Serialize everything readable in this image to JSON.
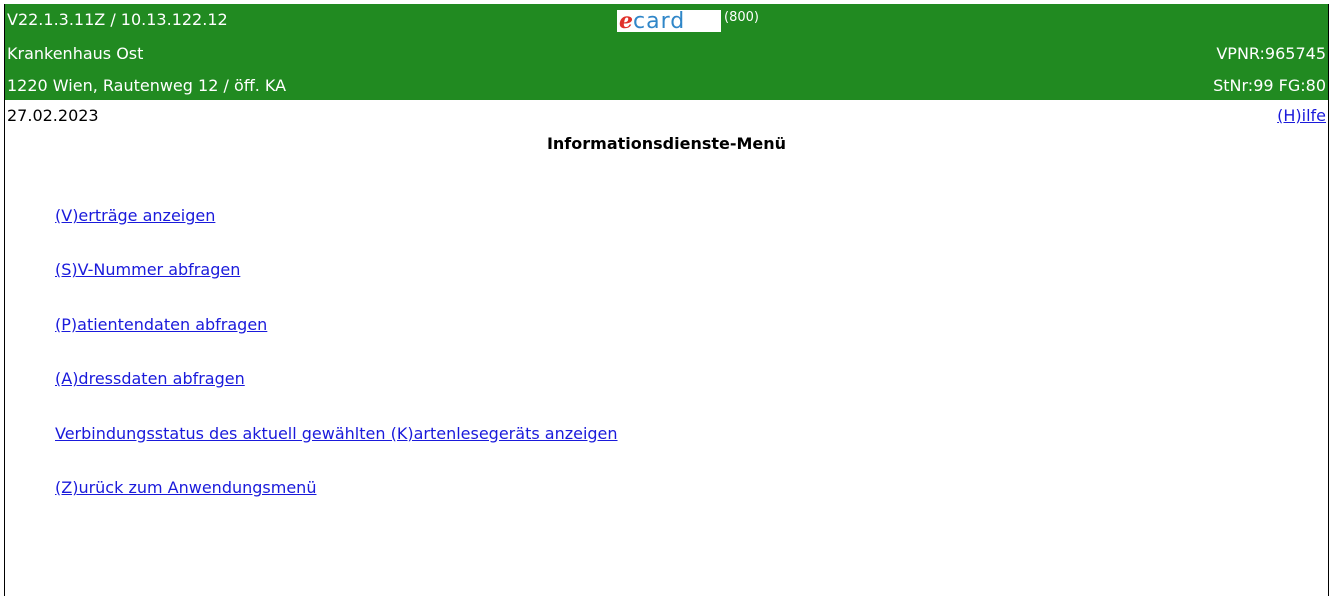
{
  "header": {
    "version_ip": "V22.1.3.11Z / 10.13.122.12",
    "logo_e": "e",
    "logo_card": "card",
    "logo_code": "(800)",
    "org_name": "Krankenhaus Ost",
    "address": "1220 Wien, Rautenweg 12 / öff. KA",
    "vpnr": "VPNR:965745",
    "stnr": "StNr:99 FG:80"
  },
  "date": "27.02.2023",
  "help_link": "(H)ilfe",
  "page_title": "Informationsdienste-Menü",
  "menu": {
    "items": [
      {
        "label": "(V)erträge anzeigen"
      },
      {
        "label": "(S)V-Nummer abfragen"
      },
      {
        "label": "(P)atientendaten abfragen"
      },
      {
        "label": "(A)dressdaten abfragen"
      },
      {
        "label": "Verbindungsstatus des aktuell gewählten (K)artenlesegeräts anzeigen"
      },
      {
        "label": "(Z)urück zum Anwendungsmenü"
      }
    ]
  },
  "colors": {
    "header_bg": "#218a21",
    "link": "#1a1adb",
    "logo_e": "#e0312a",
    "logo_card": "#2f86c8"
  }
}
